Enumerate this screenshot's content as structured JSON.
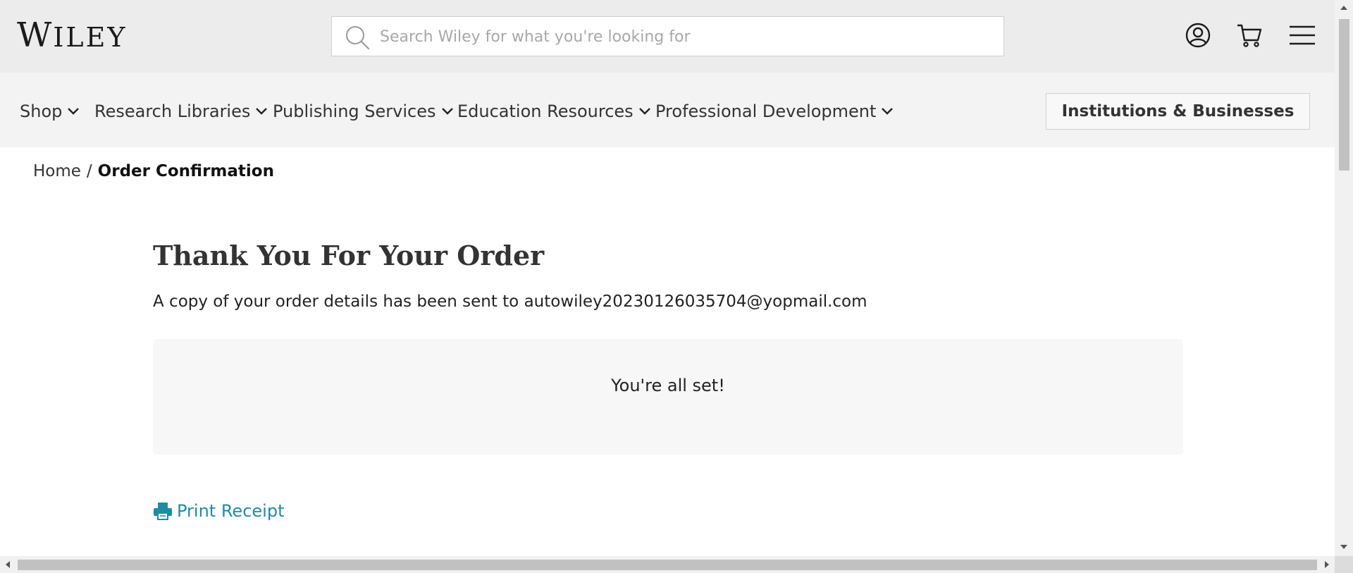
{
  "header": {
    "logo_first": "W",
    "logo_rest": "ILEY",
    "search_placeholder": "Search Wiley for what you're looking for",
    "icons": [
      "account-icon",
      "cart-icon",
      "menu-icon"
    ]
  },
  "nav": {
    "items": [
      {
        "label": "Shop"
      },
      {
        "label": "Research Libraries"
      },
      {
        "label": "Publishing Services"
      },
      {
        "label": "Education Resources"
      },
      {
        "label": "Professional Development"
      }
    ],
    "institutions_label": "Institutions & Businesses"
  },
  "breadcrumb": {
    "home": "Home",
    "separator": "/",
    "current": "Order Confirmation"
  },
  "main": {
    "title": "Thank You For Your Order",
    "subtext": "A copy of your order details has been sent to autowiley20230126035704@yopmail.com",
    "status_message": "You're all set!",
    "print_label": "Print Receipt",
    "print_icon": "printer-icon"
  },
  "colors": {
    "link": "#1f8ca3",
    "header_bg": "#ececec",
    "nav_bg": "#f3f3f3",
    "panel_bg": "#f7f7f7"
  }
}
